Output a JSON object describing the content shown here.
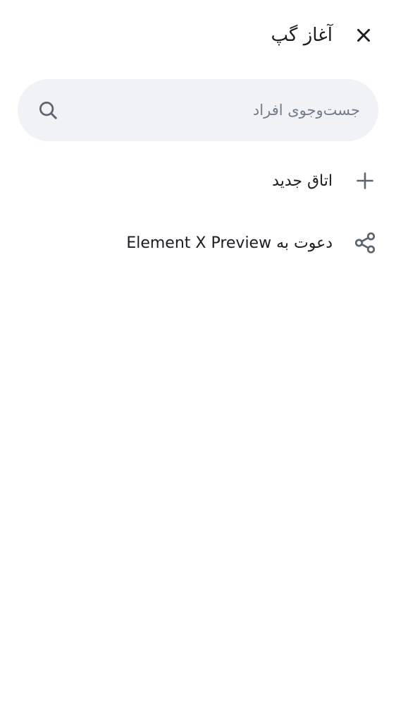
{
  "header": {
    "title": "آغاز گپ",
    "close_icon": "close-icon"
  },
  "search": {
    "placeholder": "جست‌وجوی افراد",
    "value": "",
    "icon": "search-icon"
  },
  "actions": [
    {
      "label": "اتاق جدید",
      "icon": "plus-icon"
    },
    {
      "label": "دعوت به Element X Preview",
      "icon": "share-icon"
    }
  ],
  "colors": {
    "background": "#ffffff",
    "search_background": "#f0f2f5",
    "text_primary": "#1b1d22",
    "text_secondary": "#737d8c",
    "icon": "#5c6470"
  }
}
